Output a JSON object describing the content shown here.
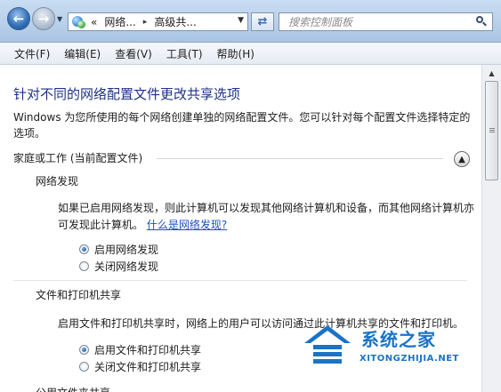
{
  "address_bar": {
    "prefix": "«",
    "segments": [
      "网络...",
      "高级共..."
    ],
    "separator": "▸"
  },
  "search": {
    "placeholder": "搜索控制面板"
  },
  "menu": [
    "文件(F)",
    "编辑(E)",
    "查看(V)",
    "工具(T)",
    "帮助(H)"
  ],
  "page": {
    "heading": "针对不同的网络配置文件更改共享选项",
    "description": "Windows 为您所使用的每个网络创建单独的网络配置文件。您可以针对每个配置文件选择特定的选项。",
    "section_title": "家庭或工作 (当前配置文件)",
    "network_discovery": {
      "title": "网络发现",
      "text": "如果已启用网络发现，则此计算机可以发现其他网络计算机和设备，而其他网络计算机亦可发现此计算机。",
      "link": "什么是网络发现?",
      "options": [
        "启用网络发现",
        "关闭网络发现"
      ],
      "selected": 0
    },
    "file_printer_sharing": {
      "title": "文件和打印机共享",
      "text": "启用文件和打印机共享时，网络上的用户可以访问通过此计算机共享的文件和打印机。",
      "options": [
        "启用文件和打印机共享",
        "关闭文件和打印机共享"
      ],
      "selected": 0
    },
    "next_section_partial": "公用文件夹共享"
  },
  "watermark": {
    "brand": "系统之家",
    "url": "XITONGZHIJIA.NET"
  },
  "colors": {
    "heading": "#1e3287",
    "link": "#1a51c6",
    "watermark": "#1a73c7"
  }
}
